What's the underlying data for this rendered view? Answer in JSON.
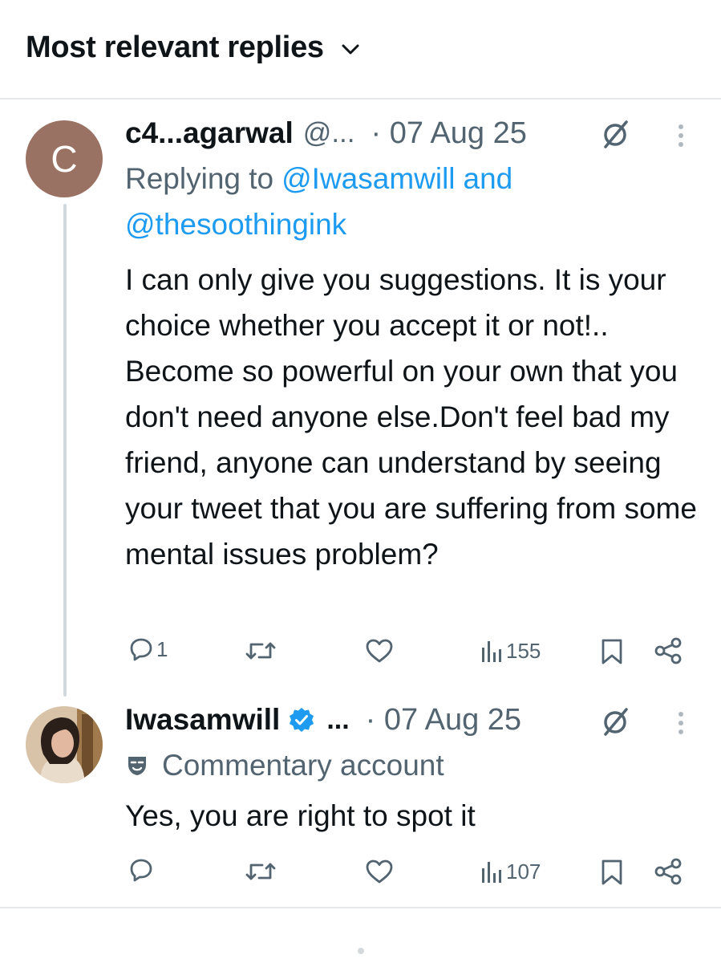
{
  "header": {
    "title": "Most relevant replies"
  },
  "replies": [
    {
      "avatar_letter": "C",
      "name": "c4...agarwal",
      "handle": "@...",
      "date": "· 07 Aug 25",
      "replying_prefix": "Replying to",
      "replying_mention_1": "@Iwasamwill",
      "replying_and": "and",
      "replying_mention_2": "@thesoothingink",
      "text": "I can only give you suggestions. It is your choice whether you accept it or not!.. Become so powerful on your own that you don't need anyone else.Don't feel bad my friend, anyone can understand by seeing your tweet that you are suffering from some mental issues problem?",
      "reply_count": "1",
      "views": "155"
    },
    {
      "name": "Iwasamwill",
      "handle": "...",
      "date": "· 07 Aug 25",
      "label": "Commentary account",
      "text": "Yes, you are right to spot it",
      "reply_count": "",
      "views": "107"
    }
  ],
  "colors": {
    "accent": "#1d9bf0",
    "secondary_text": "#536471",
    "avatar_bg": "#9a7264",
    "divider": "#e6e9ec",
    "thread_line": "#cfd9de"
  },
  "icons": [
    "chevron-down-icon",
    "grok-slash-icon",
    "more-vertical-icon",
    "reply-icon",
    "retweet-icon",
    "like-icon",
    "views-icon",
    "bookmark-icon",
    "share-icon",
    "verified-badge-icon",
    "commentary-mask-icon"
  ]
}
